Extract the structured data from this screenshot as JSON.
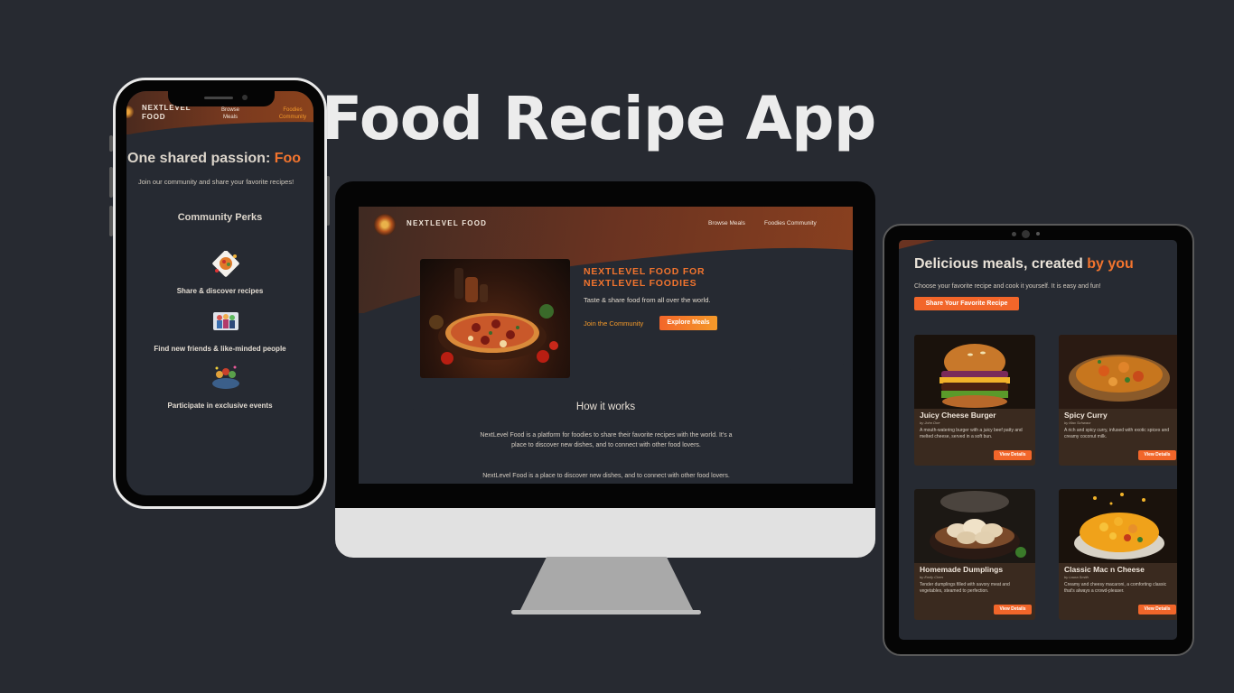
{
  "title": "Food Recipe App",
  "phone": {
    "brand_line1": "NEXTLEVEL",
    "brand_line2": "FOOD",
    "nav": [
      {
        "line1": "Browse",
        "line2": "Meals"
      },
      {
        "line1": "Foodies",
        "line2": "Community"
      }
    ],
    "hero_prefix": "One shared passion: ",
    "hero_accent": "Foo",
    "subtitle": "Join our community and share your favorite recipes!",
    "perks_title": "Community Perks",
    "perks": [
      {
        "label": "Share & discover recipes",
        "icon": "recipe-plate-icon"
      },
      {
        "label": "Find new friends & like-minded people",
        "icon": "friends-group-icon"
      },
      {
        "label": "Participate in exclusive events",
        "icon": "events-icon"
      }
    ]
  },
  "desktop": {
    "brand": "NEXTLEVEL FOOD",
    "nav": [
      "Browse Meals",
      "Foodies Community"
    ],
    "hero_title": "NEXTLEVEL FOOD FOR NEXTLEVEL FOODIES",
    "tagline": "Taste & share food from all over the world.",
    "join_link": "Join the Community",
    "explore_button": "Explore Meals",
    "how_title": "How it works",
    "paragraph1": "NextLevel Food is a platform for foodies to share their favorite recipes with the world. It's a place to discover new dishes, and to connect with other food lovers.",
    "paragraph2": "NextLevel Food is a place to discover new dishes, and to connect with other food lovers."
  },
  "tablet": {
    "heading_prefix": "Delicious meals, created ",
    "heading_accent": "by you",
    "subtitle": "Choose your favorite recipe and cook it yourself. It is easy and fun!",
    "cta": "Share Your Favorite Recipe",
    "cards": [
      {
        "title": "Juicy Cheese Burger",
        "author": "by John Doe",
        "description": "A mouth-watering burger with a juicy beef patty and melted cheese, served in a soft bun.",
        "button": "View Details"
      },
      {
        "title": "Spicy Curry",
        "author": "by Max Schwarz",
        "description": "A rich and spicy curry, infused with exotic spices and creamy coconut milk.",
        "button": "View Details"
      },
      {
        "title": "Homemade Dumplings",
        "author": "by Emily Chen",
        "description": "Tender dumplings filled with savory meat and vegetables, steamed to perfection.",
        "button": "View Details"
      },
      {
        "title": "Classic Mac n Cheese",
        "author": "by Laura Smith",
        "description": "Creamy and cheesy macaroni, a comforting classic that's always a crowd-pleaser.",
        "button": "View Details"
      }
    ]
  },
  "colors": {
    "background": "#272a31",
    "accent": "#f2742e",
    "header_brown": "#7b3a1f"
  }
}
